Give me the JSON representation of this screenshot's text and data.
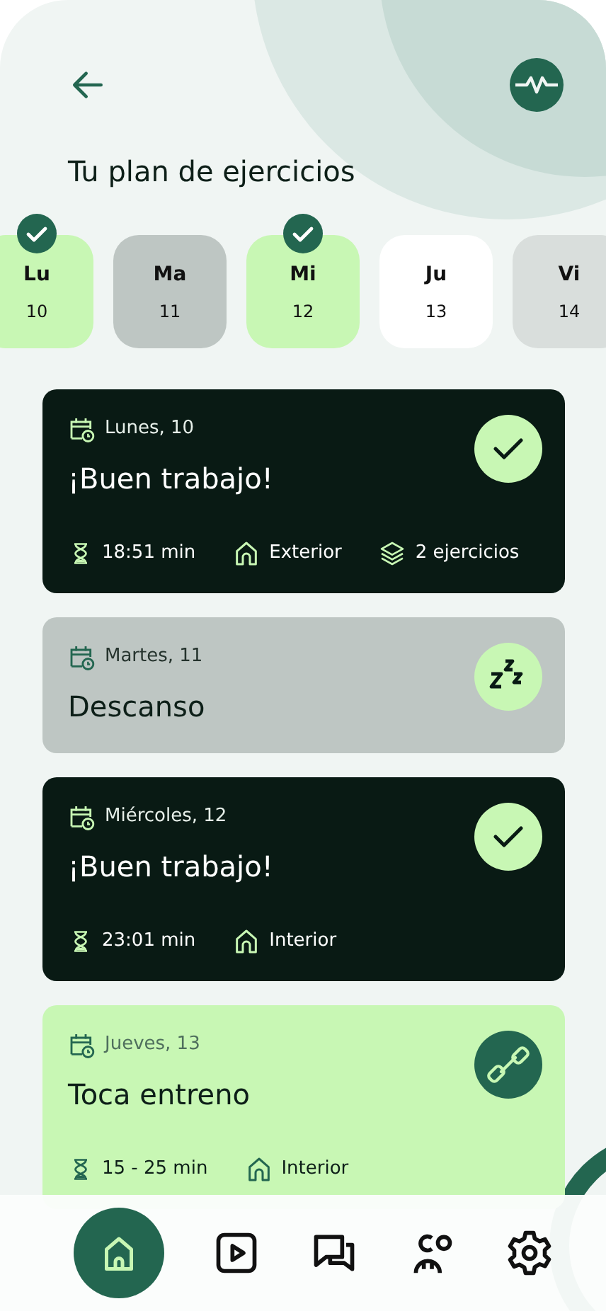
{
  "header": {
    "title": "Tu plan de ejercicios"
  },
  "days": [
    {
      "weekday": "Lu",
      "day": "10",
      "kind": "done",
      "checked": true
    },
    {
      "weekday": "Ma",
      "day": "11",
      "kind": "rest",
      "checked": false
    },
    {
      "weekday": "Mi",
      "day": "12",
      "kind": "done",
      "checked": true
    },
    {
      "weekday": "Ju",
      "day": "13",
      "kind": "today",
      "checked": false
    },
    {
      "weekday": "Vi",
      "day": "14",
      "kind": "upcoming",
      "checked": false
    }
  ],
  "sessions": [
    {
      "kind": "done",
      "date": "Lunes, 10",
      "title": "¡Buen trabajo!",
      "meta": [
        {
          "kind": "duration",
          "text": "18:51 min"
        },
        {
          "kind": "place",
          "text": "Exterior"
        },
        {
          "kind": "exercises",
          "text": "2 ejercicios"
        }
      ]
    },
    {
      "kind": "rest",
      "date": "Martes, 11",
      "title": "Descanso"
    },
    {
      "kind": "done",
      "date": "Miércoles, 12",
      "title": "¡Buen trabajo!",
      "meta": [
        {
          "kind": "duration",
          "text": "23:01 min"
        },
        {
          "kind": "place",
          "text": "Interior"
        }
      ]
    },
    {
      "kind": "planned",
      "date": "Jueves, 13",
      "title": "Toca entreno",
      "meta": [
        {
          "kind": "duration",
          "text": "15 - 25 min"
        },
        {
          "kind": "place",
          "text": "Interior"
        }
      ]
    }
  ],
  "nav": [
    {
      "kind": "home",
      "selected": true
    },
    {
      "kind": "video",
      "selected": false
    },
    {
      "kind": "chat",
      "selected": false
    },
    {
      "kind": "community",
      "selected": false
    },
    {
      "kind": "settings",
      "selected": false
    }
  ]
}
